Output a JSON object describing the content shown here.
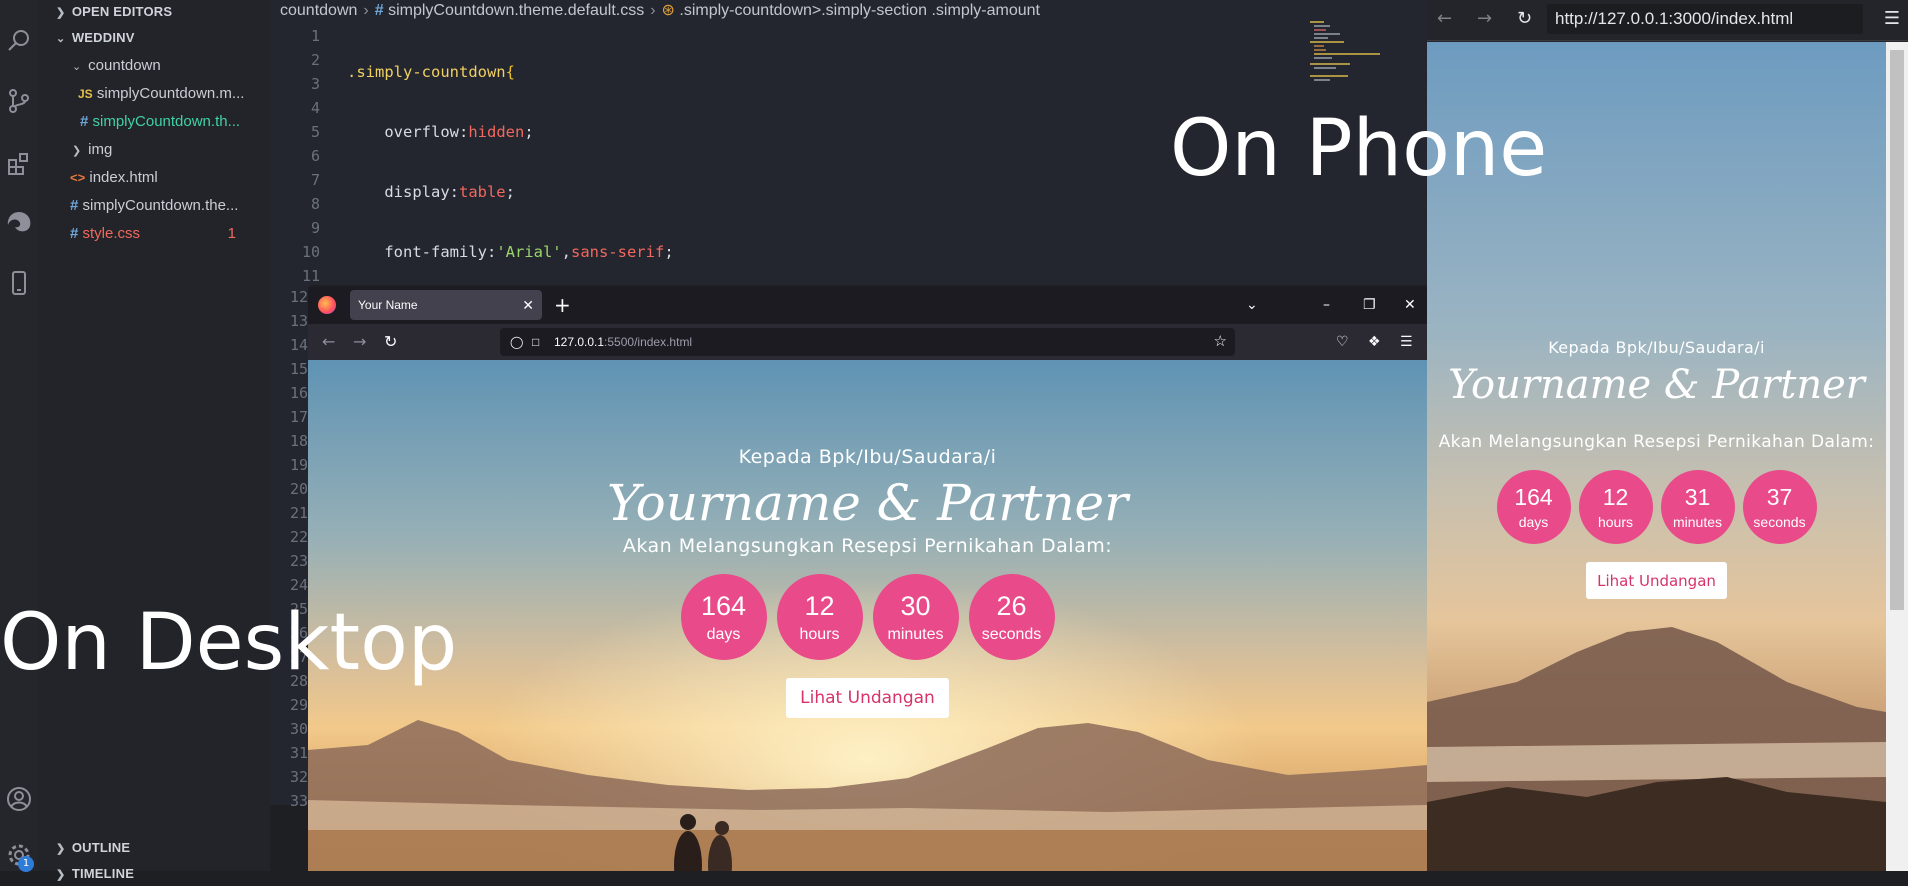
{
  "sidebar": {
    "open_editors": "OPEN EDITORS",
    "workspace": "WEDDINV",
    "items": [
      {
        "label": "countdown",
        "kind": "folder-open"
      },
      {
        "label": "simplyCountdown.m...",
        "kind": "js"
      },
      {
        "label": "simplyCountdown.th...",
        "kind": "css-active"
      },
      {
        "label": "img",
        "kind": "folder"
      },
      {
        "label": "index.html",
        "kind": "html"
      },
      {
        "label": "simplyCountdown.the...",
        "kind": "css"
      },
      {
        "label": "style.css",
        "kind": "css-error",
        "badge": "1"
      }
    ],
    "outline": "OUTLINE",
    "timeline": "TIMELINE",
    "settings_badge": "1"
  },
  "editor": {
    "breadcrumb": [
      "countdown",
      "simplyCountdown.theme.default.css",
      ".simply-countdown>.simply-section .simply-amount"
    ],
    "line_numbers_top": [
      "1",
      "2",
      "3",
      "4",
      "5",
      "6",
      "7",
      "8",
      "9",
      "10",
      "11"
    ],
    "line_numbers_bottom": [
      "12",
      "13",
      "14",
      "15",
      "16",
      "17",
      "18",
      "19",
      "20",
      "21",
      "22",
      "23",
      "24",
      "25",
      "26",
      "27",
      "28",
      "29",
      "30",
      "31",
      "32",
      "33"
    ]
  },
  "desktop_browser": {
    "tab_title": "Your Name",
    "url_host": "127.0.0.1",
    "url_rest": ":5500/index.html",
    "greeting": "Kepada Bpk/Ibu/Saudara/i",
    "names": "Yourname & Partner",
    "tagline": "Akan Melangsungkan Resepsi Pernikahan Dalam:",
    "countdown": [
      {
        "value": "164",
        "unit": "days"
      },
      {
        "value": "12",
        "unit": "hours"
      },
      {
        "value": "30",
        "unit": "minutes"
      },
      {
        "value": "26",
        "unit": "seconds"
      }
    ],
    "button": "Lihat Undangan"
  },
  "phone_browser": {
    "url": "http://127.0.0.1:3000/index.html",
    "greeting": "Kepada Bpk/Ibu/Saudara/i",
    "names": "Yourname & Partner",
    "tagline": "Akan Melangsungkan Resepsi Pernikahan Dalam:",
    "countdown": [
      {
        "value": "164",
        "unit": "days"
      },
      {
        "value": "12",
        "unit": "hours"
      },
      {
        "value": "31",
        "unit": "minutes"
      },
      {
        "value": "37",
        "unit": "seconds"
      }
    ],
    "button": "Lihat Undangan"
  },
  "overlay": {
    "phone_label": "On Phone",
    "desktop_label": "On Desktop"
  },
  "colors": {
    "countdown_circle": "#e84a8a",
    "button_text": "#d6336c"
  }
}
